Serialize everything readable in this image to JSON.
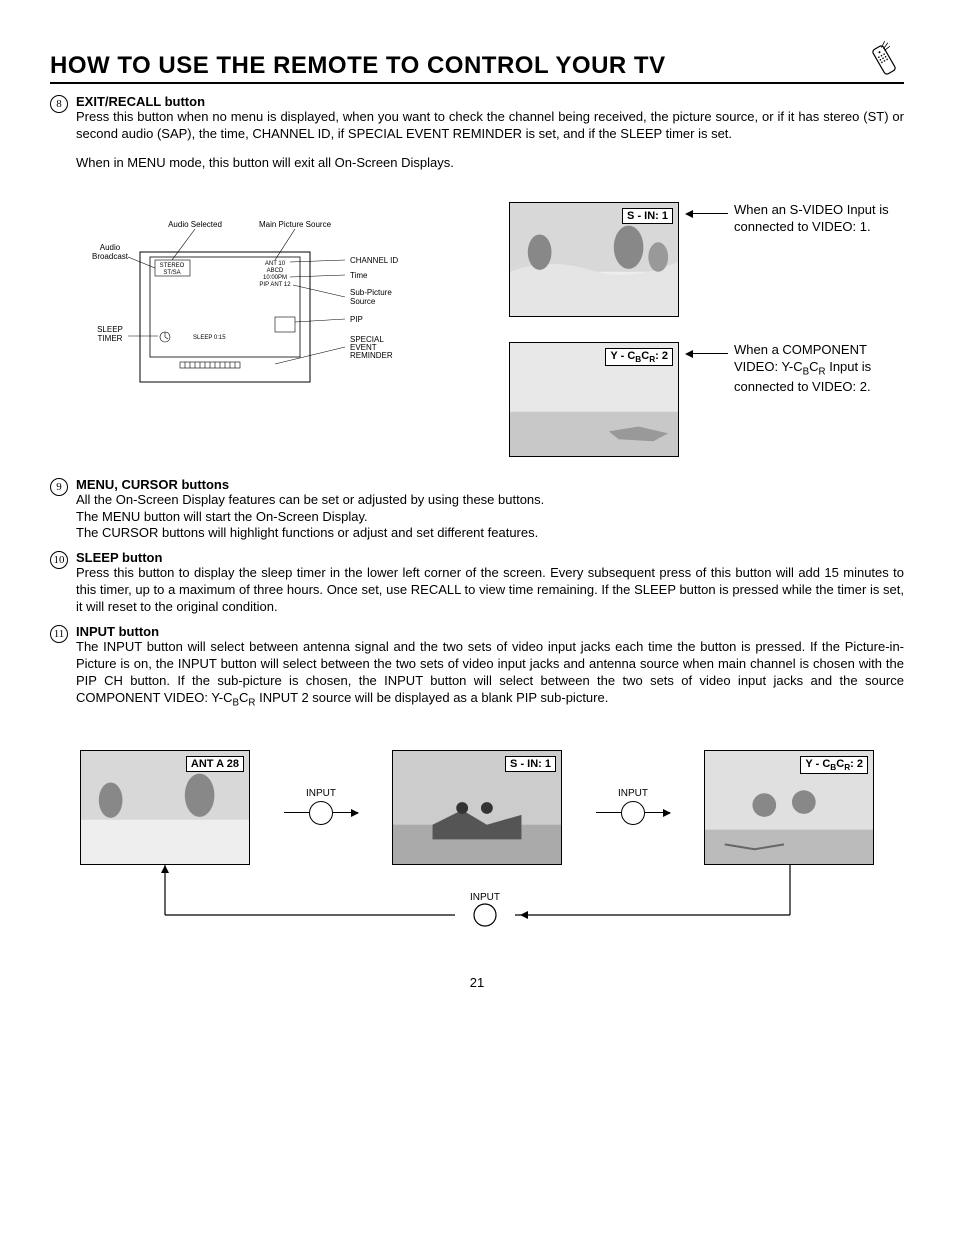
{
  "title": "HOW TO USE THE REMOTE TO CONTROL YOUR TV",
  "page_number": "21",
  "items": [
    {
      "num": "8",
      "heading": "EXIT/RECALL button",
      "paragraphs": [
        "Press this button when no menu is displayed, when you want to check the channel being received, the picture source, or if it has stereo (ST) or second audio (SAP), the time, CHANNEL ID, if SPECIAL EVENT REMINDER is set, and if the SLEEP timer is set.",
        "When in MENU mode, this button will exit all On-Screen Displays."
      ]
    },
    {
      "num": "9",
      "heading": "MENU, CURSOR buttons",
      "paragraphs": [
        "All the On-Screen Display features can be set or adjusted by using these buttons.",
        "The MENU button will start the On-Screen Display.",
        "The CURSOR buttons will highlight functions or adjust and set different features."
      ]
    },
    {
      "num": "10",
      "heading": "SLEEP button",
      "paragraphs": [
        "Press this button to display the sleep timer in the lower left corner of the screen.  Every subsequent press of this button will add 15 minutes to this timer, up to a maximum of three hours.  Once set, use RECALL to view time remaining.  If the SLEEP button is pressed while the timer is set, it will reset to the original condition."
      ]
    },
    {
      "num": "11",
      "heading": "INPUT button",
      "paragraphs": [
        "The INPUT button will select between antenna signal and the two sets of video input jacks each time the button is pressed. If the Picture-in-Picture is on, the INPUT button will select between the two sets of video input jacks and antenna source when main channel is chosen with the PIP CH button. If the sub-picture is chosen, the INPUT button will select between the two sets of video input jacks and the source COMPONENT VIDEO: Y-CʙCʀ INPUT 2 source will be displayed as a blank PIP sub-picture."
      ]
    }
  ],
  "diagram": {
    "labels": {
      "audio_selected": "Audio Selected",
      "main_picture_source": "Main Picture Source",
      "audio_broadcast": "Audio Broadcast",
      "channel_id": "CHANNEL ID",
      "time": "Time",
      "sub_picture_source": "Sub-Picture Source",
      "pip": "PIP",
      "sleep_timer": "SLEEP TIMER",
      "special_event_reminder": "SPECIAL EVENT REMINDER"
    },
    "osd": {
      "stereo": "STEREO",
      "stsa": "ST/SA",
      "ant": "ANT 10",
      "abcd": "ABCD",
      "time_val": "10:00PM",
      "pip_ant": "PIP ANT 12",
      "sleep_val": "SLEEP 0:15"
    }
  },
  "right_captions": {
    "svideo_label": "S - IN: 1",
    "svideo_text": "When an S-VIDEO Input is connected to VIDEO: 1.",
    "component_label_prefix": "Y - C",
    "component_label_suffix": ": 2",
    "component_text_prefix": "When a COMPONENT VIDEO: Y-C",
    "component_text_suffix": " Input is connected to VIDEO: 2."
  },
  "flow": {
    "ant_label": "ANT A   28",
    "sin_label": "S - IN: 1",
    "comp_prefix": "Y - C",
    "comp_suffix": ": 2",
    "input_label": "INPUT"
  }
}
